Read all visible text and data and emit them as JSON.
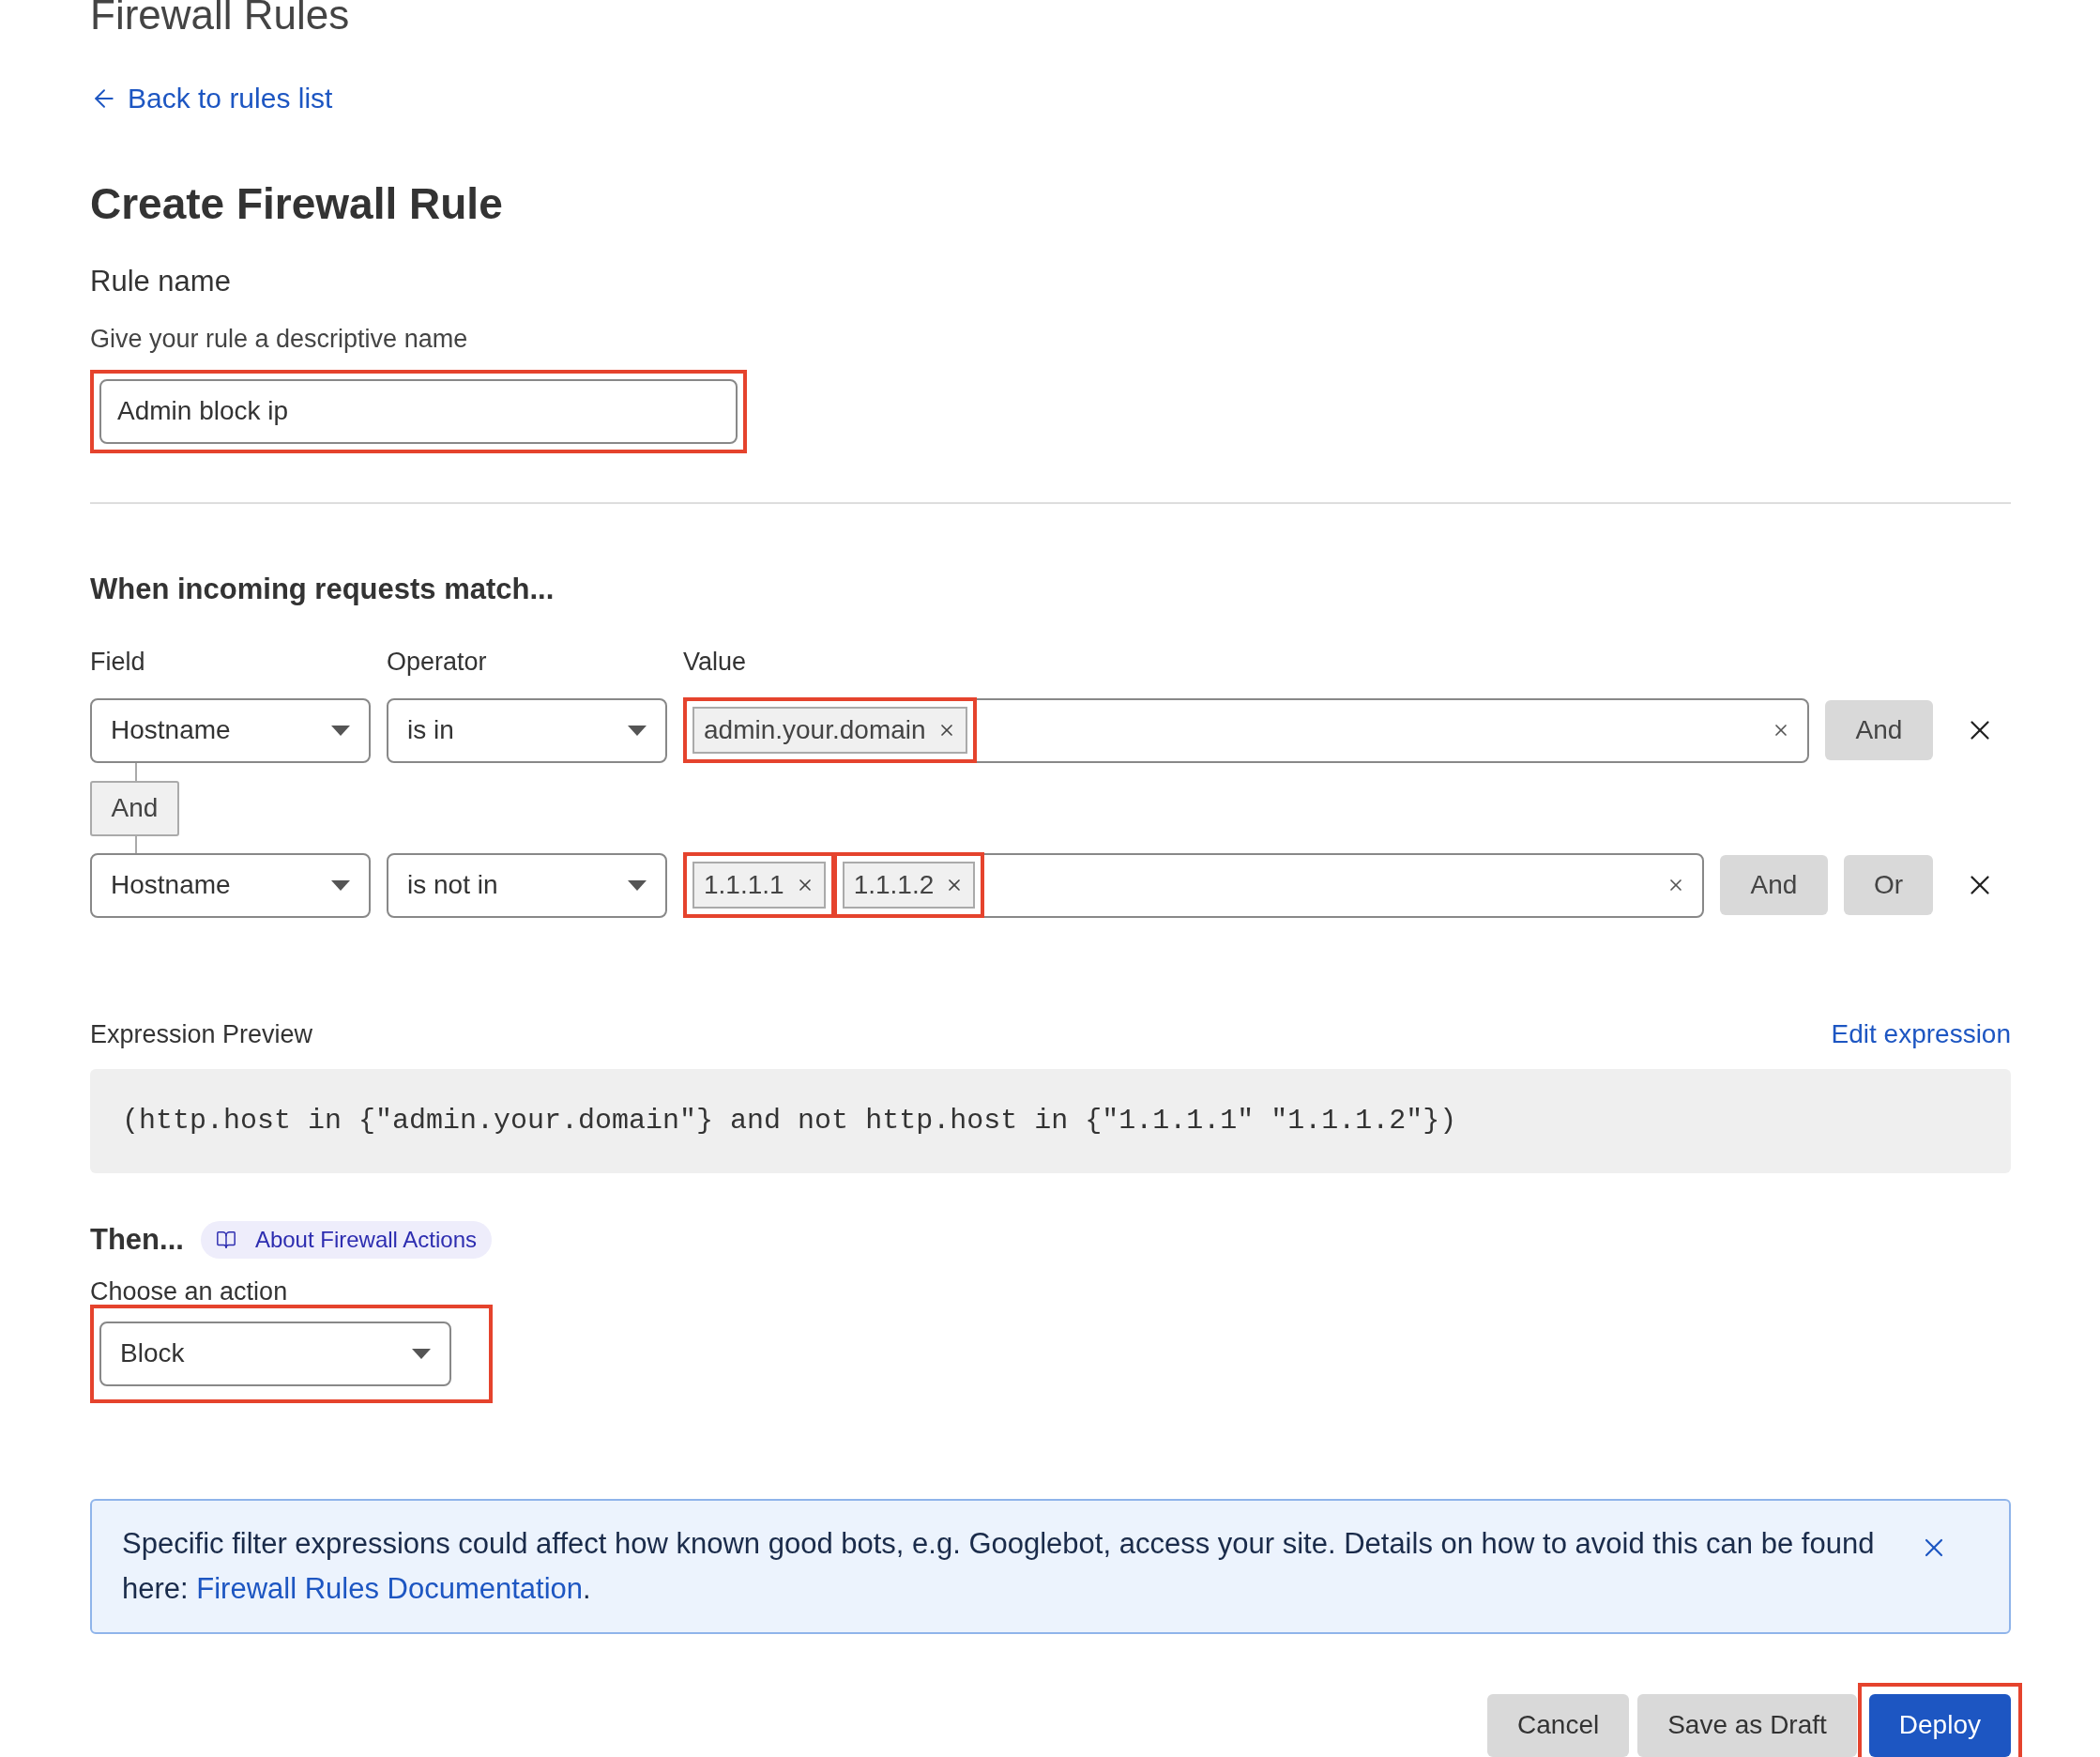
{
  "page_title": "Firewall Rules",
  "back_link": "Back to rules list",
  "heading": "Create Firewall Rule",
  "rule_name": {
    "label": "Rule name",
    "hint": "Give your rule a descriptive name",
    "value": "Admin block ip",
    "highlighted": true
  },
  "match": {
    "heading": "When incoming requests match...",
    "columns": [
      "Field",
      "Operator",
      "Value"
    ],
    "conditions": [
      {
        "field": "Hostname",
        "operator": "is in",
        "values": [
          {
            "text": "admin.your.domain",
            "highlighted": true
          }
        ],
        "buttons": [
          "And"
        ],
        "connector": "And"
      },
      {
        "field": "Hostname",
        "operator": "is not in",
        "values": [
          {
            "text": "1.1.1.1",
            "highlighted": true
          },
          {
            "text": "1.1.1.2",
            "highlighted": true
          }
        ],
        "buttons": [
          "And",
          "Or"
        ]
      }
    ]
  },
  "preview": {
    "label": "Expression Preview",
    "edit_link": "Edit expression",
    "expression": "(http.host in {\"admin.your.domain\"} and not http.host in {\"1.1.1.1\" \"1.1.1.2\"})"
  },
  "action": {
    "heading": "Then...",
    "help_link": "About Firewall Actions",
    "label": "Choose an action",
    "value": "Block",
    "highlighted": true
  },
  "notice": {
    "text": "Specific filter expressions could affect how known good bots, e.g. Googlebot, access your site. Details on how to avoid this can be found here: ",
    "link": "Firewall Rules Documentation",
    "after": "."
  },
  "buttons": [
    {
      "label": "Cancel",
      "kind": "secondary",
      "highlighted": false
    },
    {
      "label": "Save as Draft",
      "kind": "secondary",
      "highlighted": false
    },
    {
      "label": "Deploy",
      "kind": "primary",
      "highlighted": true
    }
  ]
}
